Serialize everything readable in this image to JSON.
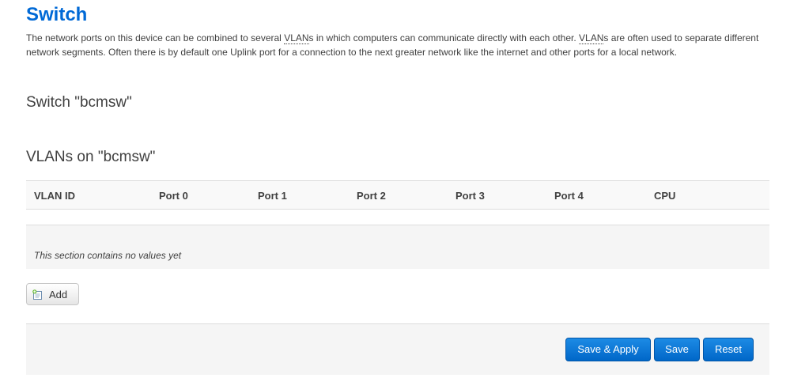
{
  "page": {
    "title": "Switch",
    "description_parts": {
      "p1": "The network ports on this device can be combined to several ",
      "vlan1": "VLAN",
      "p2": "s in which computers can communicate directly with each other. ",
      "vlan2": "VLAN",
      "p3": "s are often used to separate different network segments. Often there is by default one Uplink port for a connection to the next greater network like the internet and other ports for a local network."
    }
  },
  "switch_section": {
    "title": "Switch \"bcmsw\""
  },
  "vlan_section": {
    "title": "VLANs on \"bcmsw\"",
    "columns": [
      "VLAN ID",
      "Port 0",
      "Port 1",
      "Port 2",
      "Port 3",
      "Port 4",
      "CPU"
    ],
    "empty_text": "This section contains no values yet",
    "add_label": "Add"
  },
  "actions": {
    "save_apply": "Save & Apply",
    "save": "Save",
    "reset": "Reset"
  },
  "colors": {
    "accent": "#0069d6",
    "button_blue": "#0067c8"
  },
  "icons": {
    "add": "add-document-icon"
  }
}
